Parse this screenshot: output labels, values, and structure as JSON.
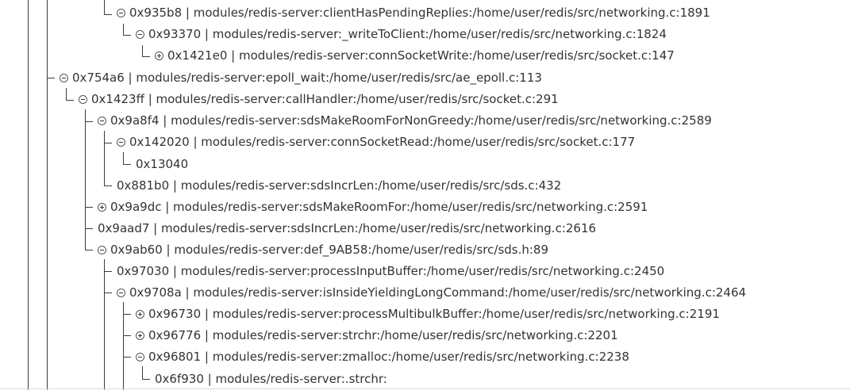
{
  "tree": {
    "nodes": [
      {
        "label": "0x935b8 | modules/redis-server:clientHasPendingReplies:/home/user/redis/src/networking.c:1891",
        "toggle": "minus"
      },
      {
        "label": "0x93370 | modules/redis-server:_writeToClient:/home/user/redis/src/networking.c:1824",
        "toggle": "minus"
      },
      {
        "label": "0x1421e0 | modules/redis-server:connSocketWrite:/home/user/redis/src/socket.c:147",
        "toggle": "plus"
      },
      {
        "label": "0x754a6 | modules/redis-server:epoll_wait:/home/user/redis/src/ae_epoll.c:113",
        "toggle": "minus"
      },
      {
        "label": "0x1423ff | modules/redis-server:callHandler:/home/user/redis/src/socket.c:291",
        "toggle": "minus"
      },
      {
        "label": "0x9a8f4 | modules/redis-server:sdsMakeRoomForNonGreedy:/home/user/redis/src/networking.c:2589",
        "toggle": "minus"
      },
      {
        "label": "0x142020 | modules/redis-server:connSocketRead:/home/user/redis/src/socket.c:177",
        "toggle": "minus"
      },
      {
        "label": "0x13040",
        "toggle": "none"
      },
      {
        "label": "0x881b0 | modules/redis-server:sdsIncrLen:/home/user/redis/src/sds.c:432",
        "toggle": "none"
      },
      {
        "label": "0x9a9dc | modules/redis-server:sdsMakeRoomFor:/home/user/redis/src/networking.c:2591",
        "toggle": "plus"
      },
      {
        "label": "0x9aad7 | modules/redis-server:sdsIncrLen:/home/user/redis/src/networking.c:2616",
        "toggle": "none"
      },
      {
        "label": "0x9ab60 | modules/redis-server:def_9AB58:/home/user/redis/src/sds.h:89",
        "toggle": "minus"
      },
      {
        "label": "0x97030 | modules/redis-server:processInputBuffer:/home/user/redis/src/networking.c:2450",
        "toggle": "none"
      },
      {
        "label": "0x9708a | modules/redis-server:isInsideYieldingLongCommand:/home/user/redis/src/networking.c:2464",
        "toggle": "minus"
      },
      {
        "label": "0x96730 | modules/redis-server:processMultibulkBuffer:/home/user/redis/src/networking.c:2191",
        "toggle": "plus"
      },
      {
        "label": "0x96776 | modules/redis-server:strchr:/home/user/redis/src/networking.c:2201",
        "toggle": "plus"
      },
      {
        "label": "0x96801 | modules/redis-server:zmalloc:/home/user/redis/src/networking.c:2238",
        "toggle": "minus"
      },
      {
        "label": "0x6f930 | modules/redis-server:.strchr:",
        "toggle": "none"
      }
    ]
  }
}
